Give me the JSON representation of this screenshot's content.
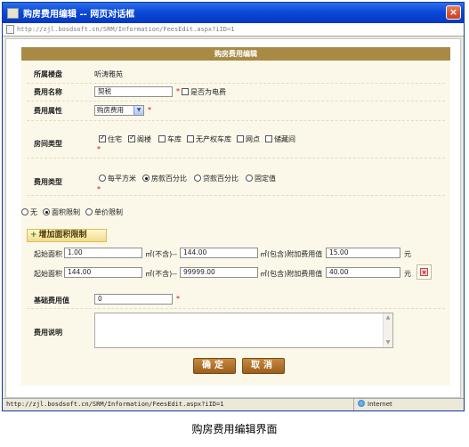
{
  "window": {
    "title": "购房费用编辑 -- 网页对话框",
    "close": "×",
    "address": "http://zjl.bosdsoft.cn/SRM/Information/FeesEdit.aspx?iID=1"
  },
  "form": {
    "header": "购房费用编辑",
    "community_label": "所属楼盘",
    "community_value": "听涛雅苑",
    "fee_name_label": "费用名称",
    "fee_name_value": "契税",
    "is_electric_label": "是否为电费",
    "fee_attr_label": "费用属性",
    "fee_attr_value": "购房费用",
    "room_type_label": "房间类型",
    "room_types": [
      {
        "label": "住宅",
        "checked": true
      },
      {
        "label": "阁楼",
        "checked": true
      },
      {
        "label": "车库",
        "checked": false
      },
      {
        "label": "无产权车库",
        "checked": false
      },
      {
        "label": "网点",
        "checked": false
      },
      {
        "label": "储藏间",
        "checked": false
      }
    ],
    "fee_type_label": "费用类型",
    "fee_types": [
      {
        "label": "每平方米",
        "checked": false
      },
      {
        "label": "房款百分比",
        "checked": true
      },
      {
        "label": "贷款百分比",
        "checked": false
      },
      {
        "label": "固定值",
        "checked": false
      }
    ],
    "limit_types": [
      {
        "label": "无",
        "checked": false
      },
      {
        "label": "面积限制",
        "checked": true
      },
      {
        "label": "单价限制",
        "checked": false
      }
    ],
    "add_area_limit": "增加面积限制",
    "area_rows": [
      {
        "start_label": "起始面积",
        "start": "1.00",
        "mid_label": "㎡(不含)--",
        "end": "144.00",
        "extra_label": "㎡(包含)附加费用值",
        "fee": "15.00",
        "unit": "元"
      },
      {
        "start_label": "起始面积",
        "start": "144.00",
        "mid_label": "㎡(不含)--",
        "end": "99999.00",
        "extra_label": "㎡(包含)附加费用值",
        "fee": "40.00",
        "unit": "元"
      }
    ],
    "base_fee_label": "基础费用值",
    "base_fee_value": "0",
    "desc_label": "费用说明",
    "required_mark": "*",
    "ok_label": "确定",
    "cancel_label": "取消"
  },
  "statusbar": {
    "url": "http://zjl.bosdsoft.cn/SRM/Information/FeesEdit.aspx?iID=1",
    "zone": "Internet"
  },
  "caption": "购房费用编辑界面",
  "colors": {
    "header_bg": "#a88a45",
    "button_bg": "#b0742e",
    "panel_bg": "#fbf8ea"
  }
}
